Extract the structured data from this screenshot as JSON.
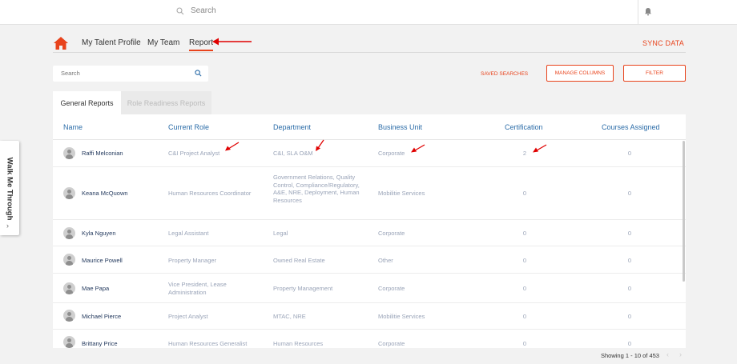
{
  "top": {
    "search_placeholder": "Search"
  },
  "nav": {
    "items": [
      "My Talent Profile",
      "My Team",
      "Report"
    ],
    "sync": "SYNC DATA"
  },
  "filters": {
    "search_placeholder": "Search",
    "saved_searches": "SAVED SEARCHES",
    "manage_columns": "MANAGE COLUMNS",
    "filter": "FILTER"
  },
  "tabs": [
    "General Reports",
    "Role Readiness Reports"
  ],
  "table": {
    "columns": [
      "Name",
      "Current Role",
      "Department",
      "Business Unit",
      "Certification",
      "Courses Assigned"
    ],
    "rows": [
      {
        "name": "Raffi Melconian",
        "role": "C&I Project Analyst",
        "department": "C&I, SLA O&M",
        "business_unit": "Corporate",
        "certification": "2",
        "courses": "0"
      },
      {
        "name": "Keana McQuown",
        "role": "Human Resources Coordinator",
        "department": "Government Relations, Quality Control, Compliance/Regulatory, A&E, NRE, Deployment, Human Resources",
        "business_unit": "Mobilitie Services",
        "certification": "0",
        "courses": "0"
      },
      {
        "name": "Kyla Nguyen",
        "role": "Legal Assistant",
        "department": "Legal",
        "business_unit": "Corporate",
        "certification": "0",
        "courses": "0"
      },
      {
        "name": "Maurice Powell",
        "role": "Property Manager",
        "department": "Owned Real Estate",
        "business_unit": "Other",
        "certification": "0",
        "courses": "0"
      },
      {
        "name": "Mae Papa",
        "role": "Vice President, Lease Administration",
        "department": "Property Management",
        "business_unit": "Corporate",
        "certification": "0",
        "courses": "0"
      },
      {
        "name": "Michael Pierce",
        "role": "Project Analyst",
        "department": "MTAC, NRE",
        "business_unit": "Mobilitie Services",
        "certification": "0",
        "courses": "0"
      },
      {
        "name": "Brittany Price",
        "role": "Human Resources Generalist",
        "department": "Human Resources",
        "business_unit": "Corporate",
        "certification": "0",
        "courses": "0"
      }
    ]
  },
  "walk_me": {
    "label": "Walk Me Through",
    "chevron": "›"
  },
  "footer": {
    "showing": "Showing 1 - 10 of 453",
    "prev": "‹",
    "next": "›"
  },
  "icons": [
    "search-icon",
    "bell-icon",
    "home-icon",
    "chevron-right-icon",
    "avatar-icon"
  ],
  "colors": {
    "accent": "#e8431c",
    "link": "#2b6ca8",
    "annotation": "#e00000"
  }
}
